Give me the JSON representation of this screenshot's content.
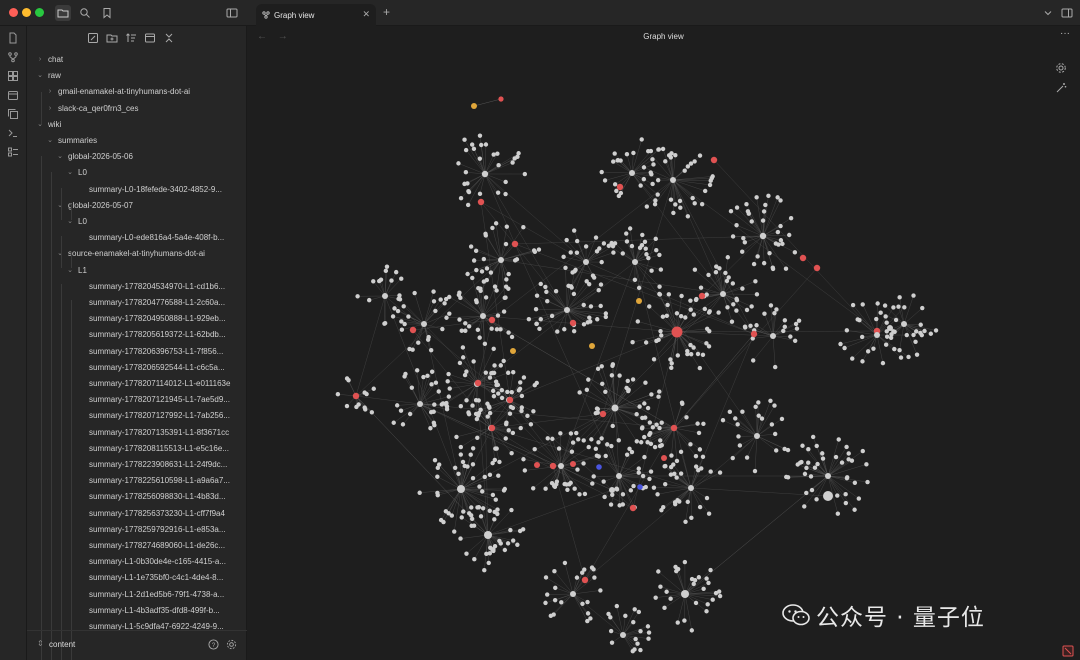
{
  "titlebar": {
    "tab_title": "Graph view",
    "new_tab": "+"
  },
  "main": {
    "view_title": "Graph view",
    "more": "···"
  },
  "sidebar": {
    "vault_name": "content",
    "items": [
      {
        "label": "chat",
        "depth": 0,
        "arrow": "›"
      },
      {
        "label": "raw",
        "depth": 0,
        "arrow": "⌄"
      },
      {
        "label": "gmail-enamakel-at-tinyhumans-dot-ai",
        "depth": 1,
        "arrow": "›"
      },
      {
        "label": "slack-ca_qer0frn3_ces",
        "depth": 1,
        "arrow": "›"
      },
      {
        "label": "wiki",
        "depth": 0,
        "arrow": "⌄"
      },
      {
        "label": "summaries",
        "depth": 1,
        "arrow": "⌄"
      },
      {
        "label": "global-2026-05-06",
        "depth": 2,
        "arrow": "⌄"
      },
      {
        "label": "L0",
        "depth": 3,
        "arrow": "⌄"
      },
      {
        "label": "summary-L0-18fefede-3402-4852-9...",
        "depth": 4,
        "arrow": ""
      },
      {
        "label": "global-2026-05-07",
        "depth": 2,
        "arrow": "⌄"
      },
      {
        "label": "L0",
        "depth": 3,
        "arrow": "⌄"
      },
      {
        "label": "summary-L0-ede816a4-5a4e-408f-b...",
        "depth": 4,
        "arrow": ""
      },
      {
        "label": "source-enamakel-at-tinyhumans-dot-ai",
        "depth": 2,
        "arrow": "⌄"
      },
      {
        "label": "L1",
        "depth": 3,
        "arrow": "⌄"
      },
      {
        "label": "summary-1778204534970-L1-cd1b6...",
        "depth": 4,
        "arrow": ""
      },
      {
        "label": "summary-1778204776588-L1-2c60a...",
        "depth": 4,
        "arrow": ""
      },
      {
        "label": "summary-1778204950888-L1-929eb...",
        "depth": 4,
        "arrow": ""
      },
      {
        "label": "summary-1778205619372-L1-62bdb...",
        "depth": 4,
        "arrow": ""
      },
      {
        "label": "summary-1778206396753-L1-7f856...",
        "depth": 4,
        "arrow": ""
      },
      {
        "label": "summary-1778206592544-L1-c6c5a...",
        "depth": 4,
        "arrow": ""
      },
      {
        "label": "summary-1778207114012-L1-e011163e",
        "depth": 4,
        "arrow": ""
      },
      {
        "label": "summary-1778207121945-L1-7ae5d9...",
        "depth": 4,
        "arrow": ""
      },
      {
        "label": "summary-1778207127992-L1-7ab256...",
        "depth": 4,
        "arrow": ""
      },
      {
        "label": "summary-1778207135391-L1-8f3671cc",
        "depth": 4,
        "arrow": ""
      },
      {
        "label": "summary-1778208115513-L1-e5c16e...",
        "depth": 4,
        "arrow": ""
      },
      {
        "label": "summary-1778223908631-L1-24f9dc...",
        "depth": 4,
        "arrow": ""
      },
      {
        "label": "summary-1778225610598-L1-a9a6a7...",
        "depth": 4,
        "arrow": ""
      },
      {
        "label": "summary-1778256098830-L1-4b83d...",
        "depth": 4,
        "arrow": ""
      },
      {
        "label": "summary-1778256373230-L1-cff7f9a4",
        "depth": 4,
        "arrow": ""
      },
      {
        "label": "summary-1778259792916-L1-e853a...",
        "depth": 4,
        "arrow": ""
      },
      {
        "label": "summary-1778274689060-L1-de26c...",
        "depth": 4,
        "arrow": ""
      },
      {
        "label": "summary-L1-0b30de4e-c165-4415-a...",
        "depth": 4,
        "arrow": ""
      },
      {
        "label": "summary-L1-1e735bf0-c4c1-4de4-8...",
        "depth": 4,
        "arrow": ""
      },
      {
        "label": "summary-L1-2d1ed5b6-79f1-4738-a...",
        "depth": 4,
        "arrow": ""
      },
      {
        "label": "summary-L1-4b3adf35-dfd8-499f-b...",
        "depth": 4,
        "arrow": ""
      },
      {
        "label": "summary-L1-5c9dfa47-6922-4249-9...",
        "depth": 4,
        "arrow": ""
      }
    ]
  },
  "watermark": {
    "text": "公众号 · 量子位"
  },
  "colors": {
    "node_default": "#cfcfcf",
    "node_red": "#e05252",
    "node_yellow": "#e0a63a",
    "node_blue": "#4a55e0",
    "edge": "#5a5a5a"
  }
}
